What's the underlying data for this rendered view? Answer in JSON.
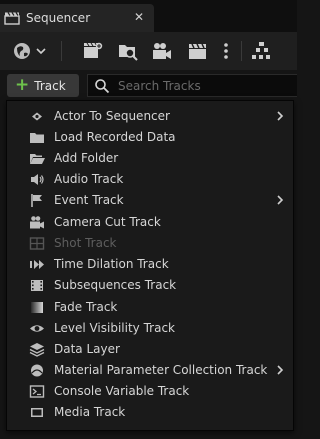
{
  "tab": {
    "title": "Sequencer",
    "close_symbol": "✕"
  },
  "toolbar": {
    "buttons": [
      "world-settings-icon",
      "save-sequence-icon",
      "find-in-content-browser-icon",
      "render-movie-icon",
      "clapperboard-icon",
      "more-options-icon",
      "hierarchy-icon"
    ]
  },
  "add_track": {
    "label": "Track"
  },
  "search": {
    "placeholder": "Search Tracks",
    "value": ""
  },
  "menu": {
    "items": [
      {
        "label": "Actor To Sequencer",
        "icon": "actor-icon",
        "submenu": true,
        "disabled": false
      },
      {
        "label": "Load Recorded Data",
        "icon": "folder-icon",
        "submenu": false,
        "disabled": false
      },
      {
        "label": "Add Folder",
        "icon": "open-folder-icon",
        "submenu": false,
        "disabled": false
      },
      {
        "label": "Audio Track",
        "icon": "speaker-icon",
        "submenu": false,
        "disabled": false
      },
      {
        "label": "Event Track",
        "icon": "flag-icon",
        "submenu": true,
        "disabled": false
      },
      {
        "label": "Camera Cut Track",
        "icon": "camera-icon",
        "submenu": false,
        "disabled": false
      },
      {
        "label": "Shot Track",
        "icon": "shot-icon",
        "submenu": false,
        "disabled": true
      },
      {
        "label": "Time Dilation Track",
        "icon": "play-fast-icon",
        "submenu": false,
        "disabled": false
      },
      {
        "label": "Subsequences Track",
        "icon": "film-strip-icon",
        "submenu": false,
        "disabled": false
      },
      {
        "label": "Fade Track",
        "icon": "fade-icon",
        "submenu": false,
        "disabled": false
      },
      {
        "label": "Level Visibility Track",
        "icon": "eye-icon",
        "submenu": false,
        "disabled": false
      },
      {
        "label": "Data Layer",
        "icon": "layers-icon",
        "submenu": false,
        "disabled": false
      },
      {
        "label": "Material Parameter Collection Track",
        "icon": "material-sphere-icon",
        "submenu": true,
        "disabled": false
      },
      {
        "label": "Console Variable Track",
        "icon": "console-icon",
        "submenu": false,
        "disabled": false
      },
      {
        "label": "Media Track",
        "icon": "media-icon",
        "submenu": false,
        "disabled": false
      }
    ]
  },
  "colors": {
    "accent_green": "#6ec24c",
    "background": "#151515",
    "menu_background": "#1a1a1a"
  }
}
